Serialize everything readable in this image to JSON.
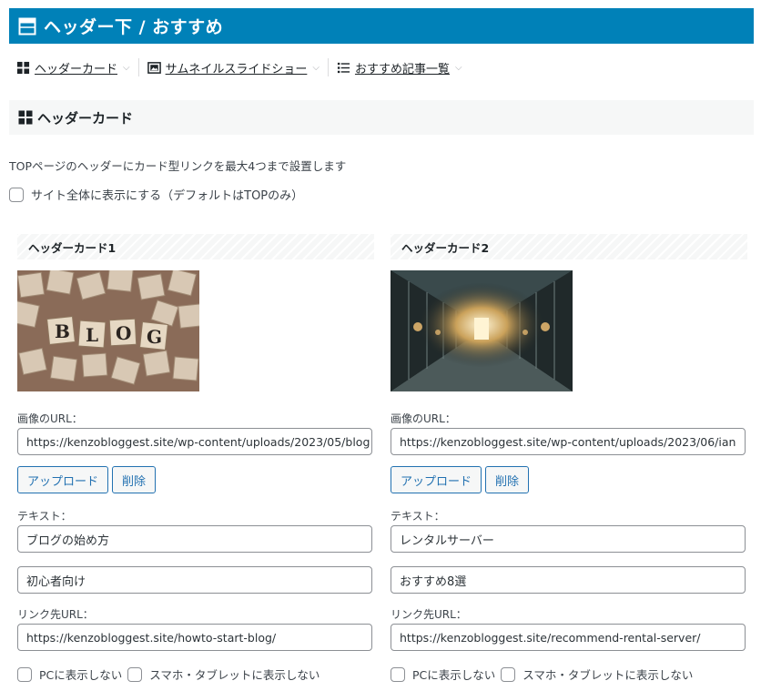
{
  "title": "ヘッダー下 / おすすめ",
  "tabs": [
    {
      "label": "ヘッダーカード",
      "icon": "grid-icon"
    },
    {
      "label": "サムネイルスライドショー",
      "icon": "image-icon"
    },
    {
      "label": "おすすめ記事一覧",
      "icon": "list-icon"
    }
  ],
  "section_title": "ヘッダーカード",
  "description": "TOPページのヘッダーにカード型リンクを最大4つまで設置します",
  "show_all_site_label": "サイト全体に表示にする（デフォルトはTOPのみ）",
  "colors": {
    "accent": "#0081b8",
    "button": "#2271b1"
  },
  "cards": [
    {
      "heading": "ヘッダーカード1",
      "image_label": "画像のURL：",
      "image_url": "https://kenzobloggest.site/wp-content/uploads/2023/05/blog",
      "upload_label": "アップロード",
      "delete_label": "削除",
      "text_label": "テキスト：",
      "text1": "ブログの始め方",
      "text2": "初心者向け",
      "link_label": "リンク先URL：",
      "link_url": "https://kenzobloggest.site/howto-start-blog/",
      "hide_pc_label": "PCに表示しない",
      "hide_sp_label": "スマホ・タブレットに表示しない"
    },
    {
      "heading": "ヘッダーカード2",
      "image_label": "画像のURL：",
      "image_url": "https://kenzobloggest.site/wp-content/uploads/2023/06/ian",
      "upload_label": "アップロード",
      "delete_label": "削除",
      "text_label": "テキスト：",
      "text1": "レンタルサーバー",
      "text2": "おすすめ8選",
      "link_label": "リンク先URL：",
      "link_url": "https://kenzobloggest.site/recommend-rental-server/",
      "hide_pc_label": "PCに表示しない",
      "hide_sp_label": "スマホ・タブレットに表示しない"
    }
  ]
}
